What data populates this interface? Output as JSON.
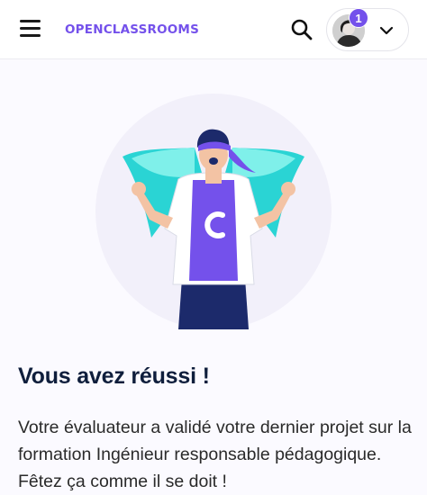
{
  "header": {
    "logo_text": "OPENCLASSROOMS",
    "notification_count": "1",
    "brand_color": "#7451eb"
  },
  "icons": {
    "menu": "hamburger-icon",
    "search": "search-icon",
    "chevron": "chevron-down-icon"
  },
  "main": {
    "title": "Vous avez réussi !",
    "message": "Votre évaluateur a validé votre dernier projet sur la formation Ingénieur responsable pédagogique. Fêtez ça comme il se doit !"
  }
}
